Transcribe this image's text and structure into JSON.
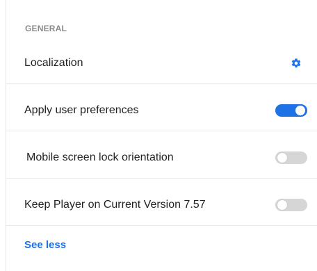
{
  "section": {
    "header": "GENERAL"
  },
  "settings": [
    {
      "label": "Localization",
      "control": "gear-icon"
    },
    {
      "label": "Apply user preferences",
      "control": "toggle",
      "on": true
    },
    {
      "label": "Mobile screen lock orientation",
      "control": "toggle",
      "on": false
    },
    {
      "label": "Keep Player on Current Version 7.57",
      "control": "toggle",
      "on": false
    }
  ],
  "footer": {
    "see_less": "See less"
  },
  "colors": {
    "accent": "#1f71e6",
    "toggle_off": "#d6d6d6",
    "section_header": "#8a8a8a"
  }
}
